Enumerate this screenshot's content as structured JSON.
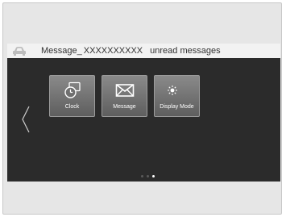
{
  "status_bar": {
    "icon": "car-icon",
    "message_label": "Message_",
    "message_count": "XXXXXXXXXX",
    "unread_label": "unread messages"
  },
  "navigation": {
    "back_icon": "chevron-left-icon"
  },
  "tiles": [
    {
      "label": "Clock",
      "icon": "clock-icon"
    },
    {
      "label": "Message",
      "icon": "envelope-icon"
    },
    {
      "label": "Display Mode",
      "icon": "sun-moon-icon"
    }
  ],
  "pagination": {
    "total_pages": 3,
    "current_page": 3
  },
  "colors": {
    "screen_background": "#2b2b2b",
    "tile_background": "#6f6f6f",
    "status_bar_background": "#f2f2f2",
    "frame_background": "#e6e6e6"
  }
}
